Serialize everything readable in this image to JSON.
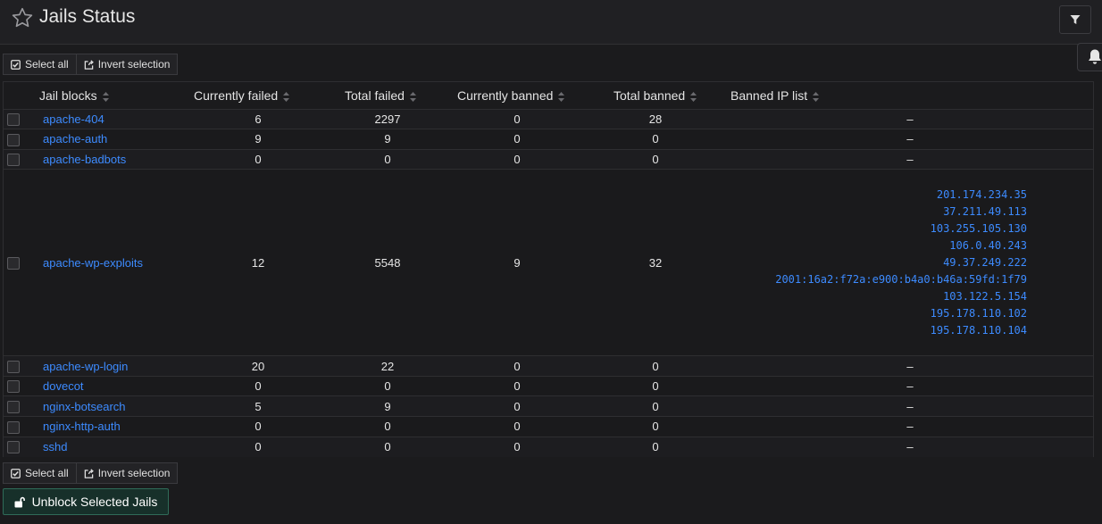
{
  "page": {
    "title": "Jails Status"
  },
  "icons": {
    "star": "star-outline-icon",
    "filter": "filter-icon",
    "bell": "bell-icon",
    "select_all": "check-square-icon",
    "invert": "share-square-icon",
    "sort": "sort-icon",
    "unlock": "unlock-icon"
  },
  "colors": {
    "link": "#3d8bff",
    "unblock_bg": "#17302a",
    "unblock_border": "#2f6b58"
  },
  "toolbar": {
    "select_all": "Select all",
    "invert_selection": "Invert selection"
  },
  "table": {
    "columns": [
      "Jail blocks",
      "Currently failed",
      "Total failed",
      "Currently banned",
      "Total banned",
      "Banned IP list"
    ],
    "rows": [
      {
        "name": "apache-404",
        "currently_failed": "6",
        "total_failed": "2297",
        "currently_banned": "0",
        "total_banned": "28",
        "banned_ips": [],
        "empty": "–"
      },
      {
        "name": "apache-auth",
        "currently_failed": "9",
        "total_failed": "9",
        "currently_banned": "0",
        "total_banned": "0",
        "banned_ips": [],
        "empty": "–"
      },
      {
        "name": "apache-badbots",
        "currently_failed": "0",
        "total_failed": "0",
        "currently_banned": "0",
        "total_banned": "0",
        "banned_ips": [],
        "empty": "–"
      },
      {
        "name": "apache-wp-exploits",
        "currently_failed": "12",
        "total_failed": "5548",
        "currently_banned": "9",
        "total_banned": "32",
        "banned_ips": [
          "201.174.234.35",
          "37.211.49.113",
          "103.255.105.130",
          "106.0.40.243",
          "49.37.249.222",
          "2001:16a2:f72a:e900:b4a0:b46a:59fd:1f79",
          "103.122.5.154",
          "195.178.110.102",
          "195.178.110.104"
        ],
        "empty": ""
      },
      {
        "name": "apache-wp-login",
        "currently_failed": "20",
        "total_failed": "22",
        "currently_banned": "0",
        "total_banned": "0",
        "banned_ips": [],
        "empty": "–"
      },
      {
        "name": "dovecot",
        "currently_failed": "0",
        "total_failed": "0",
        "currently_banned": "0",
        "total_banned": "0",
        "banned_ips": [],
        "empty": "–"
      },
      {
        "name": "nginx-botsearch",
        "currently_failed": "5",
        "total_failed": "9",
        "currently_banned": "0",
        "total_banned": "0",
        "banned_ips": [],
        "empty": "–"
      },
      {
        "name": "nginx-http-auth",
        "currently_failed": "0",
        "total_failed": "0",
        "currently_banned": "0",
        "total_banned": "0",
        "banned_ips": [],
        "empty": "–"
      },
      {
        "name": "sshd",
        "currently_failed": "0",
        "total_failed": "0",
        "currently_banned": "0",
        "total_banned": "0",
        "banned_ips": [],
        "empty": "–"
      }
    ]
  },
  "actions": {
    "unblock": "Unblock Selected Jails"
  }
}
